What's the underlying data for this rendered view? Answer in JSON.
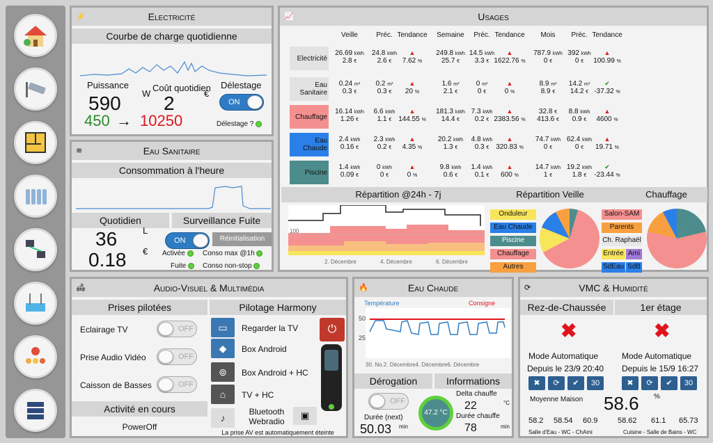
{
  "nav": [
    "house-icon",
    "camera-icon",
    "floorplan-icon",
    "radiator-icon",
    "network-icon",
    "pool-icon",
    "map-people-icon",
    "server-icon"
  ],
  "elec": {
    "title": "Electricité",
    "sub": "Courbe de charge quotidienne",
    "puissance_l": "Puissance",
    "puissance": "590",
    "unit_w": "W",
    "cout_l": "Coût quotidien",
    "cout": "2",
    "unit_eur": "€",
    "delestage_l": "Délestage",
    "delestage_state": "ON",
    "min": "450",
    "arrow": "→",
    "max": "10250",
    "delestage_q": "Délestage ?"
  },
  "eau": {
    "title": "Eau Sanitaire",
    "sub": "Consommation à l'heure",
    "quot_l": "Quotidien",
    "surv_l": "Surveillance Fuite",
    "litres": "36",
    "unit_l": "L",
    "eur": "0.18",
    "unit_eur": "€",
    "state": "ON",
    "reset": "Réinitialisation",
    "activee": "Activée",
    "conso1h": "Conso max @1h",
    "fuite": "Fuite",
    "nonstop": "Conso non-stop"
  },
  "usages": {
    "title": "Usages",
    "headers": [
      "Veille",
      "Préc.",
      "Tendance",
      "Semaine",
      "Préc.",
      "Tendance",
      "Mois",
      "Préc.",
      "Tendance"
    ],
    "rows": [
      {
        "label": "Electricité",
        "color": "#e2e2e2",
        "v1": "26.69",
        "u1": "kWh",
        "v2": "24.8",
        "u2": "kWh",
        "t1": "",
        "w1": "249.8",
        "wu1": "kWh",
        "w2": "14.5",
        "wu2": "kWh",
        "m1": "787.9",
        "mu1": "kWh",
        "m2": "392",
        "mu2": "kWh",
        "b1": "2.8",
        "b1u": "€",
        "b2": "2.6",
        "b2u": "€",
        "bt": "7.62",
        "bw1": "25.7",
        "bw2": "3.3",
        "btw": "1622.76",
        "bm1": "0",
        "bm2": "0",
        "btm": "100.99",
        "dir": [
          "up",
          "up",
          "up"
        ]
      },
      {
        "label": "Eau Sanitaire",
        "color": "#e2e2e2",
        "v1": "0.24",
        "u1": "m³",
        "v2": "0.2",
        "u2": "m³",
        "w1": "1.6",
        "wu1": "m³",
        "w2": "0",
        "wu2": "m³",
        "m1": "8.9",
        "mu1": "m³",
        "m2": "14.2",
        "mu2": "m³",
        "b1": "0.3",
        "b1u": "€",
        "b2": "0.3",
        "b2u": "€",
        "bt": "20",
        "bw1": "2.1",
        "bw2": "0",
        "btw": "0",
        "bm1": "8.9",
        "bm2": "14.2",
        "btm": "-37.32",
        "dir": [
          "up",
          "up",
          "down"
        ]
      },
      {
        "label": "Chauffage",
        "color": "#f59090",
        "v1": "16.14",
        "u1": "kWh",
        "v2": "6.6",
        "u2": "kWh",
        "w1": "181.3",
        "wu1": "kWh",
        "w2": "7.3",
        "wu2": "kWh",
        "m1": "32.8",
        "mu1": "€",
        "m2": "8.8",
        "mu2": "kWh",
        "b1": "1.26",
        "b1u": "€",
        "b2": "1.1",
        "b2u": "€",
        "bt": "144.55",
        "bw1": "14.4",
        "bw2": "0.2",
        "btw": "2383.56",
        "bm1": "413.6",
        "bm2": "0.9",
        "btm": "4600",
        "dir": [
          "up",
          "up",
          "up"
        ]
      },
      {
        "label": "Eau Chaude",
        "color": "#2a7fe8",
        "v1": "2.4",
        "u1": "kWh",
        "v2": "2.3",
        "u2": "kWh",
        "w1": "20.2",
        "wu1": "kWh",
        "w2": "4.8",
        "wu2": "kWh",
        "m1": "74.7",
        "mu1": "kWh",
        "m2": "62.4",
        "mu2": "kWh",
        "b1": "0.16",
        "b1u": "€",
        "b2": "0.2",
        "b2u": "€",
        "bt": "4.35",
        "bw1": "1.3",
        "bw2": "0.3",
        "btw": "320.83",
        "bm1": "0",
        "bm2": "0",
        "btm": "19.71",
        "dir": [
          "up",
          "up",
          "up"
        ]
      },
      {
        "label": "Piscine",
        "color": "#4d8c8c",
        "v1": "1.4",
        "u1": "kWh",
        "v2": "0",
        "u2": "kWh",
        "w1": "9.8",
        "wu1": "kWh",
        "w2": "1.4",
        "wu2": "kWh",
        "m1": "14.7",
        "mu1": "kWh",
        "m2": "19.2",
        "mu2": "kWh",
        "b1": "0.09",
        "b1u": "€",
        "b2": "0",
        "b2u": "€",
        "bt": "0",
        "bw1": "0.6",
        "bw2": "0.1",
        "btw": "600",
        "bm1": "1",
        "bm2": "1.8",
        "btm": "-23.44",
        "dir": [
          "up",
          "up",
          "down"
        ]
      }
    ],
    "pct": "%",
    "rep_title": "Répartition @24h - 7j",
    "rep_veille": "Répartition Veille",
    "chauffage": "Chauffage",
    "rep_axis": "100",
    "rep_dates": [
      "2. Décembre",
      "4. Décembre",
      "6. Décembre"
    ],
    "veille_legend": [
      "Onduleur",
      "Eau Chaude",
      "Piscine",
      "Chauffage",
      "Autres"
    ],
    "chauf_legend": [
      "Salon-SAM",
      "Parents",
      "Ch. Raphaël",
      "Entrée",
      "Ami",
      "SdEau",
      "SdB"
    ]
  },
  "av": {
    "title": "Audio-Visuel & Multimédia",
    "prises": "Prises pilotées",
    "harmony": "Pilotage Harmony",
    "items": [
      "Eclairage TV",
      "Prise Audio Vidéo",
      "Caisson de Basses"
    ],
    "off": "OFF",
    "activite": "Activité en cours",
    "poweroff": "PowerOff",
    "harm": [
      "Regarder la TV",
      "Box Android",
      "Box Android + HC",
      "TV + HC",
      "Bluetooth Webradio"
    ],
    "note": "La prise AV est automatiquement éteinte"
  },
  "ec": {
    "title": "Eau Chaude",
    "temp": "Température",
    "consigne": "Consigne",
    "y50": "50",
    "y25": "25",
    "dates": "30. No.2. Décembre4. Décembre6. Décembre",
    "derog": "Dérogation",
    "info": "Informations",
    "off": "OFF",
    "gauge": "47.2 °C",
    "delta_l": "Delta chauffe",
    "delta": "22",
    "delta_u": "°C",
    "duree_next_l": "Durée (next)",
    "duree_next": "50.03",
    "min": "min",
    "duree_l": "Durée chauffe",
    "duree": "78"
  },
  "vmc": {
    "title": "VMC & Humidité",
    "rdc": "Rez-de-Chaussée",
    "etage": "1er étage",
    "mode": "Mode Automatique",
    "depuis1": "Depuis le 23/9 20:40",
    "depuis2": "Depuis le 15/9 16:27",
    "btn30": "30",
    "moy_l": "Moyenne Maison",
    "moy": "58.6",
    "pct": "%",
    "vals": [
      "58.2",
      "58.54",
      "60.9",
      "58.62",
      "61.1",
      "65.73"
    ],
    "room1": "Salle d'Eau - WC - ChAmi",
    "room2": "Cuisine - Salle de Bains - WC"
  },
  "colors": {
    "green": "#2a8a2a",
    "red": "#e0141e",
    "blue": "#2e7cc4"
  }
}
